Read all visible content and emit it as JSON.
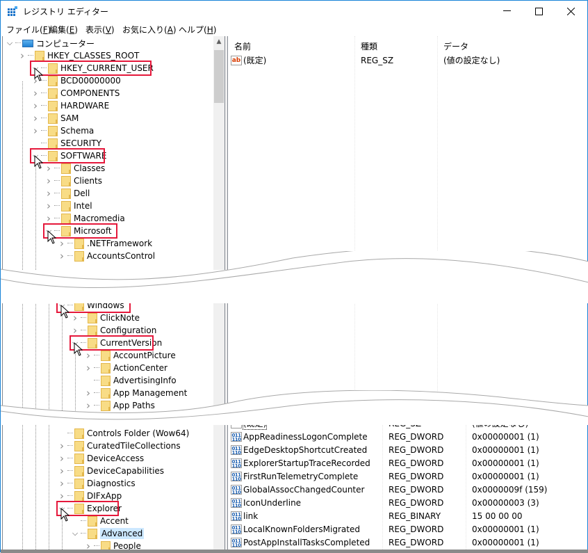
{
  "window": {
    "title": "レジストリ エディター",
    "controls": {
      "minimize": "—",
      "maximize": "☐",
      "close": "✕"
    }
  },
  "menu": [
    {
      "label": "ファイル(",
      "key": "F",
      "end": ")"
    },
    {
      "label": "編集(",
      "key": "E",
      "end": ")"
    },
    {
      "label": "表示(",
      "key": "V",
      "end": ")"
    },
    {
      "label": "お気に入り(",
      "key": "A",
      "end": ")"
    },
    {
      "label": "ヘルプ(",
      "key": "H",
      "end": ")"
    }
  ],
  "list_headers": {
    "name": "名前",
    "type": "種類",
    "data": "データ"
  },
  "section1": {
    "tree": [
      {
        "label": "コンピューター",
        "icon": "computer",
        "expander": "open"
      },
      {
        "label": "HKEY_CLASSES_ROOT",
        "expander": "closed"
      },
      {
        "label": "HKEY_CURRENT_USER",
        "expander": "open",
        "highlight": true
      },
      {
        "label": "BCD00000000",
        "expander": "closed"
      },
      {
        "label": "COMPONENTS",
        "expander": "closed"
      },
      {
        "label": "HARDWARE",
        "expander": "closed"
      },
      {
        "label": "SAM",
        "expander": "closed"
      },
      {
        "label": "Schema",
        "expander": "closed"
      },
      {
        "label": "SECURITY",
        "expander": "none"
      },
      {
        "label": "SOFTWARE",
        "expander": "open",
        "highlight": true
      },
      {
        "label": "Classes",
        "expander": "closed"
      },
      {
        "label": "Clients",
        "expander": "closed"
      },
      {
        "label": "Dell",
        "expander": "closed"
      },
      {
        "label": "Intel",
        "expander": "closed"
      },
      {
        "label": "Macromedia",
        "expander": "closed"
      },
      {
        "label": "Microsoft",
        "expander": "open",
        "highlight": true
      },
      {
        "label": ".NETFramework",
        "expander": "closed"
      },
      {
        "label": "AccountsControl",
        "expander": "closed"
      }
    ],
    "values": [
      {
        "name": "(既定)",
        "icon": "string",
        "type": "REG_SZ",
        "data": "(値の設定なし)"
      }
    ]
  },
  "section2": {
    "tree": [
      {
        "label": "Windows",
        "expander": "open",
        "highlight": true
      },
      {
        "label": "ClickNote",
        "expander": "closed"
      },
      {
        "label": "Configuration",
        "expander": "closed"
      },
      {
        "label": "CurrentVersion",
        "expander": "open",
        "highlight": true
      },
      {
        "label": "AccountPicture",
        "expander": "closed"
      },
      {
        "label": "ActionCenter",
        "expander": "closed"
      },
      {
        "label": "AdvertisingInfo",
        "expander": "none"
      },
      {
        "label": "App Management",
        "expander": "closed"
      },
      {
        "label": "App Paths",
        "expander": "closed"
      }
    ]
  },
  "section3": {
    "tree": [
      {
        "label": "Controls Folder (Wow64)",
        "expander": "none"
      },
      {
        "label": "CuratedTileCollections",
        "expander": "closed"
      },
      {
        "label": "DeviceAccess",
        "expander": "closed"
      },
      {
        "label": "DeviceCapabilities",
        "expander": "closed"
      },
      {
        "label": "Diagnostics",
        "expander": "closed"
      },
      {
        "label": "DIFxApp",
        "expander": "closed"
      },
      {
        "label": "Explorer",
        "expander": "open",
        "highlight": true
      },
      {
        "label": "Accent",
        "expander": "none"
      },
      {
        "label": "Advanced",
        "expander": "open",
        "selected": true
      },
      {
        "label": "People",
        "expander": "closed"
      }
    ],
    "values": [
      {
        "name": "(既定)",
        "icon": "string",
        "type": "REG_SZ",
        "data": "(値の設定なし)"
      },
      {
        "name": "AppReadinessLogonComplete",
        "icon": "binary",
        "type": "REG_DWORD",
        "data": "0x00000001 (1)"
      },
      {
        "name": "EdgeDesktopShortcutCreated",
        "icon": "binary",
        "type": "REG_DWORD",
        "data": "0x00000001 (1)"
      },
      {
        "name": "ExplorerStartupTraceRecorded",
        "icon": "binary",
        "type": "REG_DWORD",
        "data": "0x00000001 (1)"
      },
      {
        "name": "FirstRunTelemetryComplete",
        "icon": "binary",
        "type": "REG_DWORD",
        "data": "0x00000001 (1)"
      },
      {
        "name": "GlobalAssocChangedCounter",
        "icon": "binary",
        "type": "REG_DWORD",
        "data": "0x0000009f (159)"
      },
      {
        "name": "IconUnderline",
        "icon": "binary",
        "type": "REG_DWORD",
        "data": "0x00000003 (3)"
      },
      {
        "name": "link",
        "icon": "binary",
        "type": "REG_BINARY",
        "data": "15 00 00 00"
      },
      {
        "name": "LocalKnownFoldersMigrated",
        "icon": "binary",
        "type": "REG_DWORD",
        "data": "0x00000001 (1)"
      },
      {
        "name": "PostAppInstallTasksCompleted",
        "icon": "binary",
        "type": "REG_DWORD",
        "data": "0x00000001 (1)"
      }
    ]
  },
  "icons": {
    "string_value": "ab",
    "binary_value": "011\n110",
    "expand_open": "⌄",
    "expand_closed": "›"
  },
  "colors": {
    "highlight_border": "#e5183b",
    "selection": "#cce8ff",
    "folder": "#f8dc86",
    "window_border": "#1883d7"
  }
}
